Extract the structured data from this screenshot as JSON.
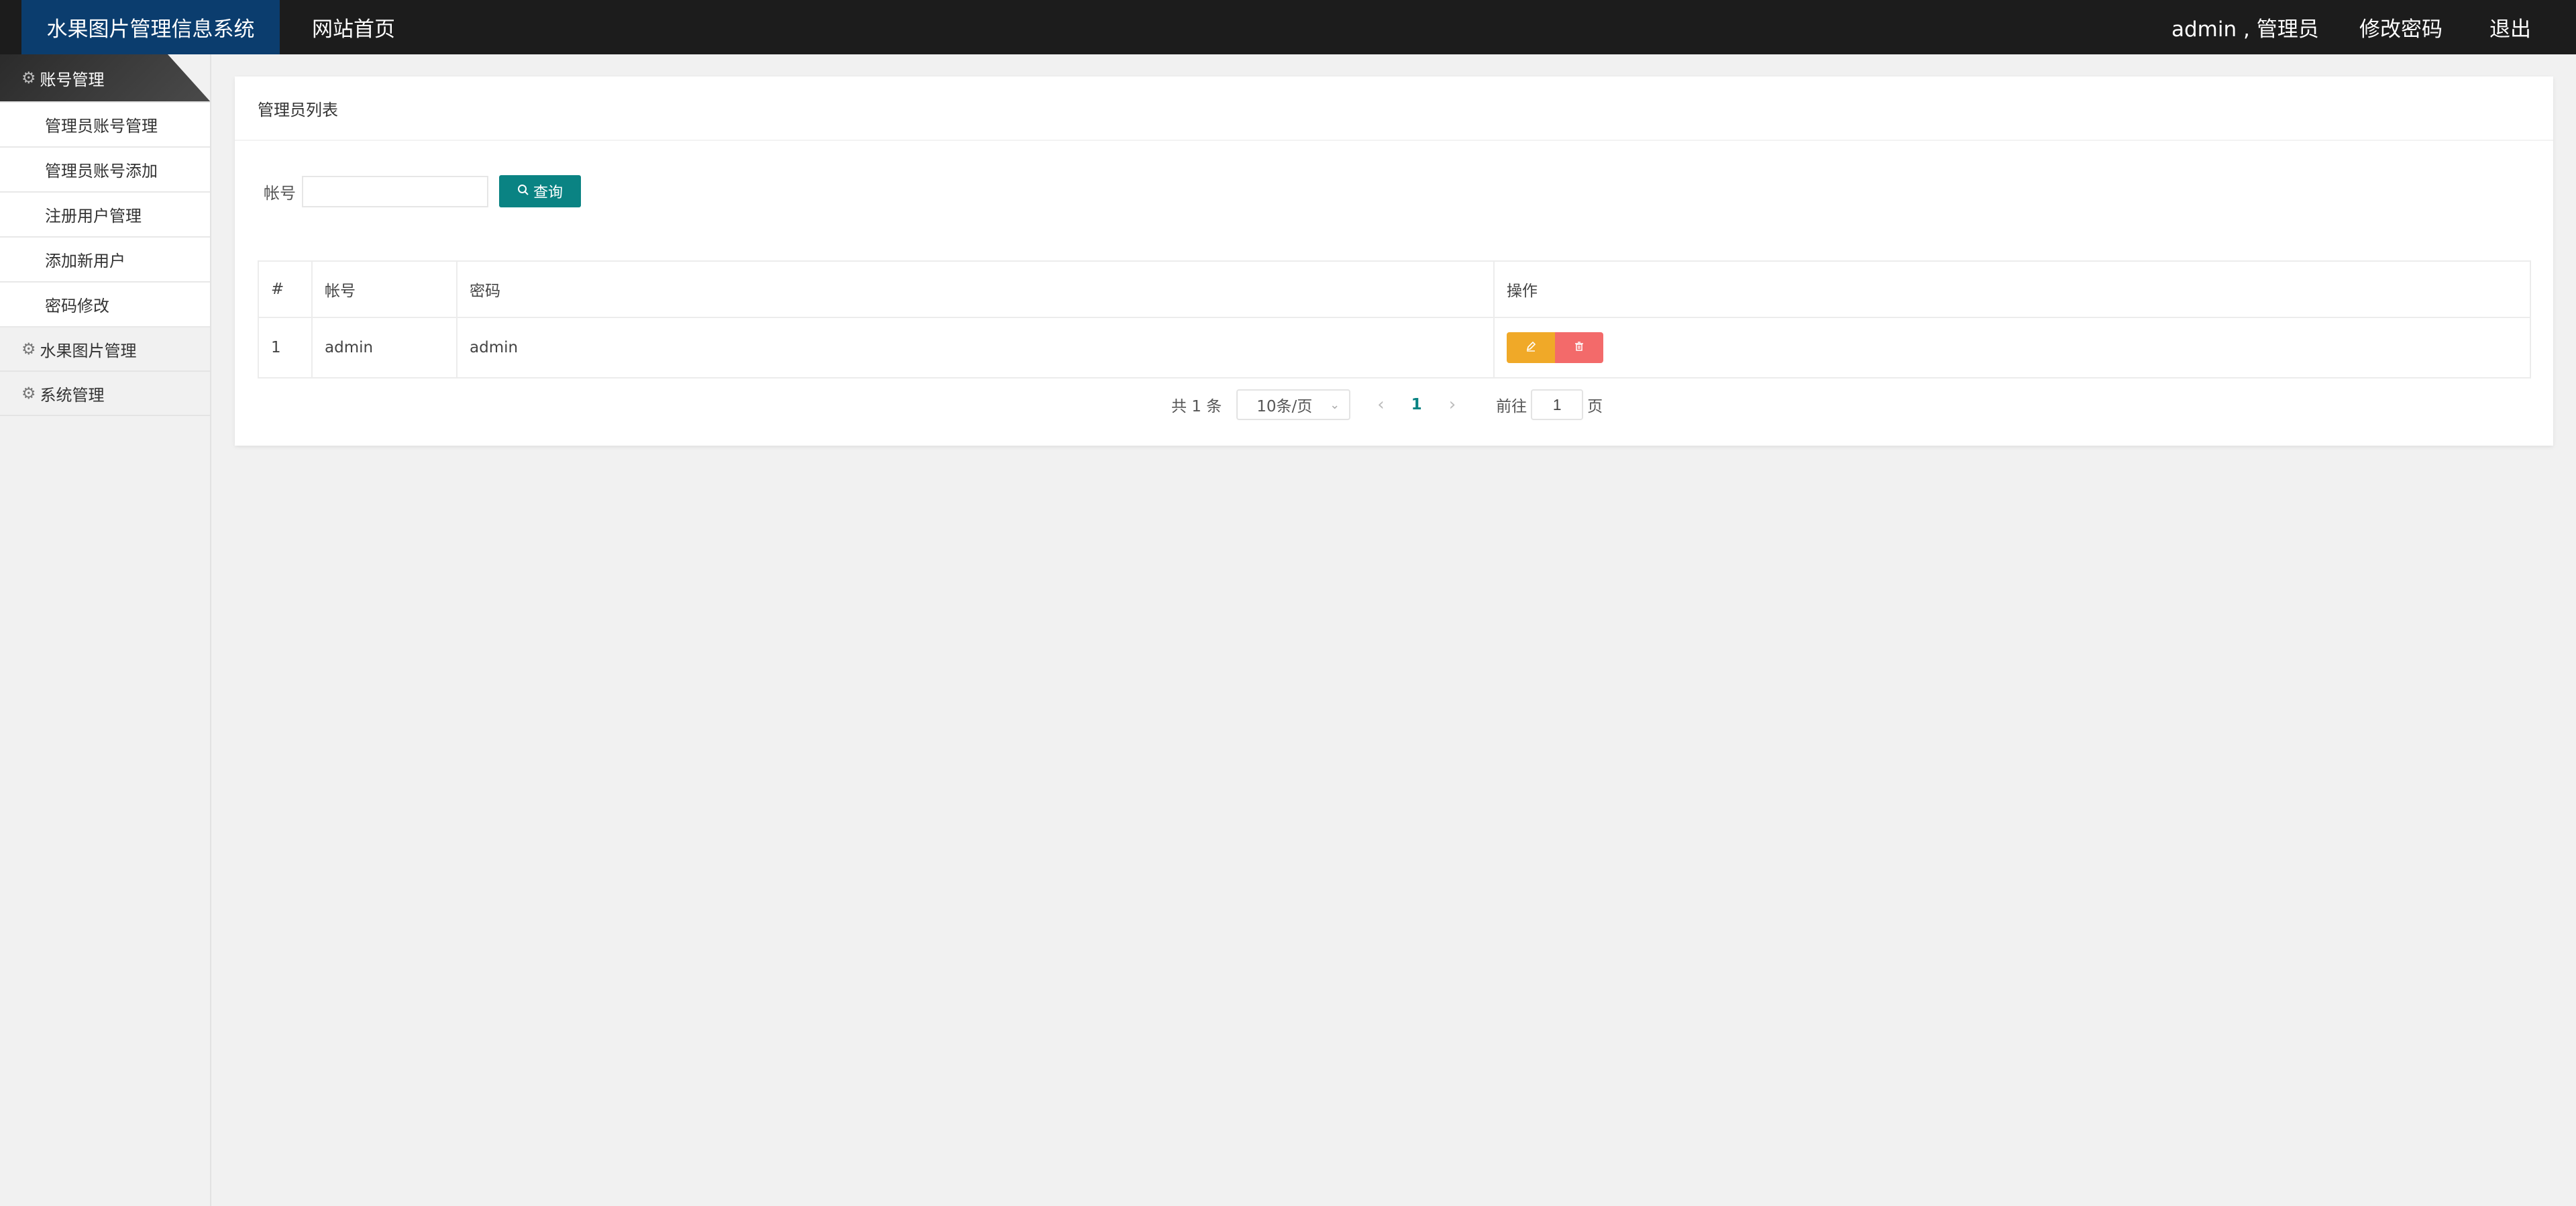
{
  "header": {
    "brand": "水果图片管理信息系统",
    "home_link": "网站首页",
    "user_info": "admin , 管理员",
    "change_password": "修改密码",
    "logout": "退出"
  },
  "sidebar": {
    "groups": [
      {
        "label": "账号管理",
        "icon": "gear-icon",
        "active": true,
        "items": [
          "管理员账号管理",
          "管理员账号添加",
          "注册用户管理",
          "添加新用户",
          "密码修改"
        ]
      },
      {
        "label": "水果图片管理",
        "icon": "gear-icon",
        "active": false
      },
      {
        "label": "系统管理",
        "icon": "gear-icon",
        "active": false
      }
    ]
  },
  "main": {
    "card_title": "管理员列表",
    "search": {
      "label": "帐号",
      "value": "",
      "button_label": "查询"
    },
    "table": {
      "headers": [
        "#",
        "帐号",
        "密码",
        "操作"
      ],
      "rows": [
        {
          "index": "1",
          "account": "admin",
          "password": "admin"
        }
      ]
    },
    "pagination": {
      "total": "共 1 条",
      "page_size": "10条/页",
      "current_page": "1",
      "goto_label": "前往",
      "goto_value": "1",
      "page_suffix": "页"
    }
  },
  "colors": {
    "topbar": "#1c1c1c",
    "brand_bg": "#0b3d6e",
    "primary": "#0a8383",
    "edit": "#f0a928",
    "delete": "#f36a6a"
  }
}
